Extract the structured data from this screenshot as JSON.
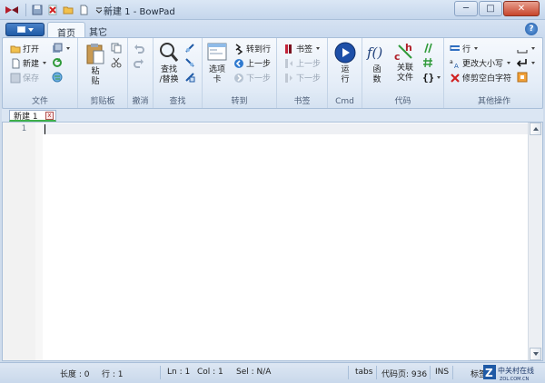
{
  "window": {
    "title": "新建 1 - BowPad",
    "minimize_label": "─",
    "maximize_label": "□",
    "close_label": "✕"
  },
  "ribbon_tabs": [
    {
      "label": "首页",
      "active": true
    },
    {
      "label": "其它",
      "active": false
    }
  ],
  "help_label": "?",
  "groups": {
    "file": {
      "label": "文件",
      "open": "打开",
      "new": "新建",
      "save": "保存"
    },
    "clipboard": {
      "label": "剪贴板",
      "paste": "粘\n贴"
    },
    "undo": {
      "label": "撤消"
    },
    "find": {
      "label": "查找",
      "find_replace": "查找\n/替换"
    },
    "goto": {
      "label": "转到",
      "tabs": "选项\n卡",
      "goto_line": "转到行",
      "prev": "上一步",
      "next": "下一步"
    },
    "bookmarks": {
      "label": "书签",
      "bookmark": "书签",
      "prev": "上一步",
      "next": "下一步"
    },
    "cmd": {
      "label": "Cmd",
      "run": "运\n行"
    },
    "code": {
      "label": "代码",
      "functions": "函\n数",
      "related_files": "关联\n文件"
    },
    "other": {
      "label": "其他操作",
      "lines": "行",
      "change_case": "更改大小写",
      "trim_ws": "修剪空白字符"
    }
  },
  "document_tab": {
    "label": "新建 1",
    "close": "x"
  },
  "editor": {
    "line_numbers": "1"
  },
  "statusbar": {
    "length": "长度 : 0",
    "lines": "行 : 1",
    "ln": "Ln : 1",
    "col": "Col : 1",
    "sel": "Sel : N/A",
    "tabs": "tabs",
    "codepage": "代码页: 936",
    "ins": "INS",
    "mark": "标签"
  },
  "watermark": {
    "line1": "中关村在线",
    "line2": "ZOL.COM.CN"
  },
  "colors": {
    "accent": "#1f5aa6",
    "ribbon_bg": "#e3ecf7",
    "tab_underline": "#3fb04a",
    "close_btn": "#c7452b"
  }
}
